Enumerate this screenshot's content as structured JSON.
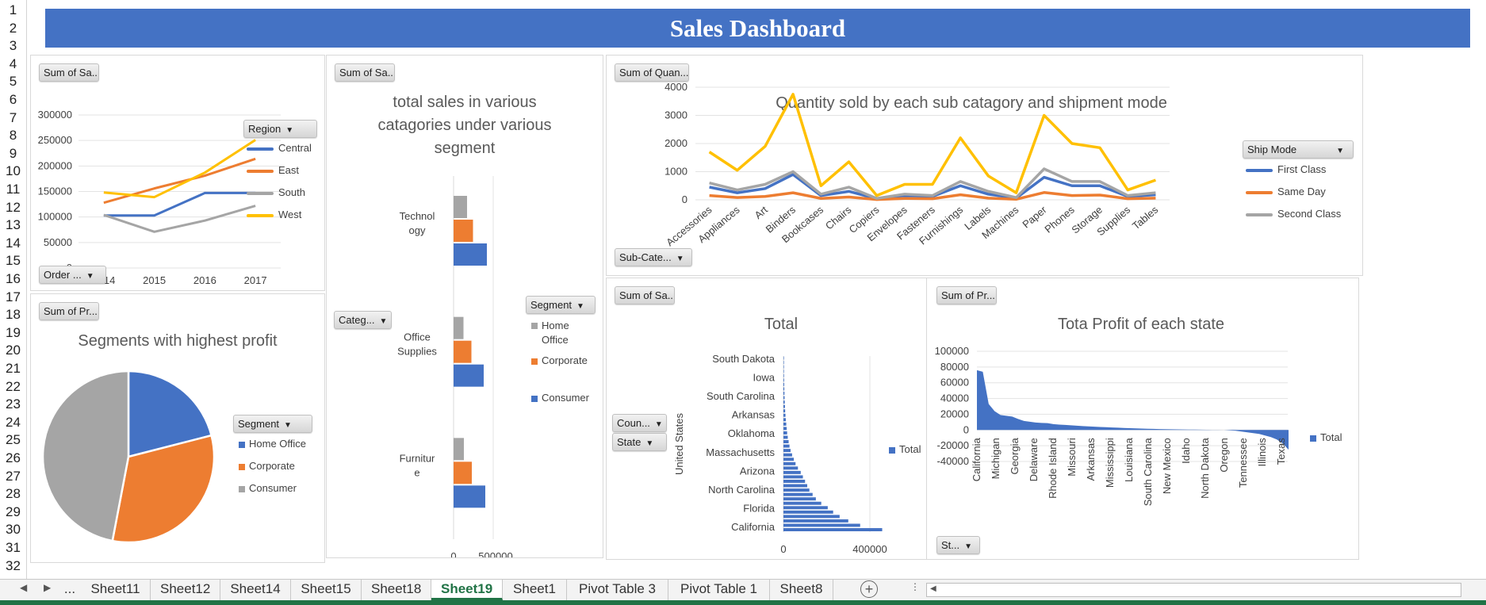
{
  "title": "Sales Dashboard",
  "rows": [
    "1",
    "2",
    "3",
    "4",
    "5",
    "6",
    "7",
    "8",
    "9",
    "10",
    "11",
    "12",
    "13",
    "14",
    "15",
    "16",
    "17",
    "18",
    "19",
    "20",
    "21",
    "22",
    "23",
    "24",
    "25",
    "26",
    "27",
    "28",
    "29",
    "30",
    "31",
    "32"
  ],
  "colors": {
    "blue": "#4472c4",
    "orange": "#ed7d31",
    "gray": "#a5a5a5",
    "yellow": "#ffc000",
    "excel_green": "#217346"
  },
  "region_chart": {
    "btn_value": "Sum of Sa...",
    "btn_axis": "Order ...",
    "btn_legend": "Region",
    "legend": [
      "Central",
      "East",
      "South",
      "West"
    ],
    "chart_data": {
      "type": "line",
      "x": [
        "2014",
        "2015",
        "2016",
        "2017"
      ],
      "yticks": [
        "300000",
        "250000",
        "200000",
        "150000",
        "100000",
        "50000",
        "0"
      ],
      "ylim": [
        0,
        300000
      ],
      "series": [
        {
          "name": "Central",
          "values": [
            103000,
            103000,
            147000,
            147000
          ]
        },
        {
          "name": "East",
          "values": [
            128000,
            156000,
            181000,
            214000
          ]
        },
        {
          "name": "South",
          "values": [
            104000,
            71000,
            93000,
            122000
          ]
        },
        {
          "name": "West",
          "values": [
            148000,
            139000,
            187000,
            251000
          ]
        }
      ]
    }
  },
  "segment_pie": {
    "title": "Segments with highest profit",
    "btn_value": "Sum of Pr...",
    "btn_legend": "Segment",
    "legend": [
      "Home Office",
      "Corporate",
      "Consumer"
    ],
    "chart_data": {
      "type": "pie",
      "labels": [
        "Home Office",
        "Corporate",
        "Consumer"
      ],
      "values": [
        21,
        32,
        47
      ]
    }
  },
  "category_chart": {
    "title_lines": [
      "total sales in various",
      "catagories under various",
      "segment"
    ],
    "btn_value": "Sum of Sa...",
    "btn_axis": "Categ...",
    "btn_legend": "Segment",
    "legend": [
      "Home Office",
      "Corporate",
      "Consumer"
    ],
    "category_labels": [
      [
        "Technol",
        "ogy"
      ],
      [
        "Office",
        "Supplies"
      ],
      [
        "Furnitur",
        "e"
      ]
    ],
    "xticks": [
      "0",
      "500000"
    ],
    "chart_data": {
      "type": "bar",
      "categories": [
        "Technology",
        "Office Supplies",
        "Furniture"
      ],
      "xlim": [
        0,
        1000000
      ],
      "series": [
        {
          "name": "Home Office",
          "values": [
            170000,
            125000,
            130000
          ]
        },
        {
          "name": "Corporate",
          "values": [
            245000,
            225000,
            230000
          ]
        },
        {
          "name": "Consumer",
          "values": [
            420000,
            380000,
            400000
          ]
        }
      ]
    }
  },
  "quantity_chart": {
    "title": "Quantity sold by each sub catagory and shipment mode",
    "btn_value": "Sum of Quan...",
    "btn_axis": "Sub-Cate...",
    "btn_legend": "Ship Mode",
    "legend": [
      "First Class",
      "Same Day",
      "Second Class"
    ],
    "chart_data": {
      "type": "line",
      "x": [
        "Accessories",
        "Appliances",
        "Art",
        "Binders",
        "Bookcases",
        "Chairs",
        "Copiers",
        "Envelopes",
        "Fasteners",
        "Furnishings",
        "Labels",
        "Machines",
        "Paper",
        "Phones",
        "Storage",
        "Supplies",
        "Tables"
      ],
      "yticks": [
        "4000",
        "3000",
        "2000",
        "1000",
        "0"
      ],
      "ylim": [
        0,
        4000
      ],
      "series": [
        {
          "name": "First Class",
          "values": [
            450,
            250,
            400,
            900,
            150,
            300,
            40,
            150,
            120,
            500,
            200,
            60,
            800,
            500,
            500,
            120,
            180
          ]
        },
        {
          "name": "Same Day",
          "values": [
            150,
            80,
            120,
            250,
            50,
            100,
            10,
            50,
            40,
            180,
            60,
            20,
            260,
            150,
            170,
            40,
            60
          ]
        },
        {
          "name": "Second Class",
          "values": [
            600,
            350,
            550,
            1000,
            200,
            450,
            50,
            200,
            150,
            650,
            300,
            80,
            1100,
            650,
            650,
            150,
            250
          ]
        },
        {
          "name": "",
          "values": [
            1700,
            1050,
            1900,
            3750,
            500,
            1350,
            150,
            550,
            550,
            2200,
            850,
            250,
            3000,
            2000,
            1850,
            350,
            700
          ]
        }
      ]
    }
  },
  "state_sales_chart": {
    "title": "Total",
    "btn_value": "Sum of Sa...",
    "btn_country": "Coun...",
    "btn_state": "State",
    "country_label": "United States",
    "legend": [
      "Total"
    ],
    "state_labels": [
      "South Dakota",
      "Iowa",
      "South Carolina",
      "Arkansas",
      "Oklahoma",
      "Massachusetts",
      "Arizona",
      "North Carolina",
      "Florida",
      "California"
    ],
    "xticks": [
      "0",
      "400000"
    ],
    "chart_data": {
      "type": "bar",
      "xlim": [
        0,
        600000
      ],
      "values": [
        1300,
        1500,
        1800,
        2100,
        2500,
        3000,
        3500,
        4000,
        4600,
        5300,
        6000,
        7000,
        8000,
        9500,
        11000,
        13000,
        15000,
        17000,
        20000,
        24000,
        28000,
        33000,
        40000,
        48000,
        56000,
        67000,
        80000,
        90000,
        100000,
        110000,
        120000,
        135000,
        150000,
        175000,
        205000,
        230000,
        260000,
        300000,
        355000,
        457000
      ]
    }
  },
  "state_profit_chart": {
    "title": "Tota Profit of each state",
    "btn_value": "Sum of Pr...",
    "btn_axis": "St...",
    "legend": [
      "Total"
    ],
    "xlabels": [
      "California",
      "Michigan",
      "Georgia",
      "Delaware",
      "Rhode Island",
      "Missouri",
      "Arkansas",
      "Mississippi",
      "Louisiana",
      "South Carolina",
      "New Mexico",
      "Idaho",
      "North Dakota",
      "Oregon",
      "Tennessee",
      "Illinois",
      "Texas"
    ],
    "yticks": [
      "100000",
      "80000",
      "60000",
      "40000",
      "20000",
      "0",
      "-20000",
      "-40000"
    ],
    "chart_data": {
      "type": "area",
      "ylim": [
        -40000,
        100000
      ],
      "values": [
        76000,
        74000,
        33000,
        24000,
        19000,
        18000,
        17000,
        14000,
        11500,
        10500,
        9500,
        9000,
        8700,
        7500,
        6800,
        6500,
        6000,
        5500,
        5000,
        4600,
        4200,
        3800,
        3500,
        3200,
        2900,
        2600,
        2300,
        2000,
        1800,
        1600,
        1400,
        1200,
        1000,
        900,
        800,
        700,
        600,
        500,
        400,
        300,
        200,
        100,
        0,
        -500,
        -1000,
        -2000,
        -3000,
        -4000,
        -5000,
        -7000,
        -9000,
        -12000,
        -17000,
        -25000
      ]
    }
  },
  "tabs": [
    "...",
    "Sheet11",
    "Sheet12",
    "Sheet14",
    "Sheet15",
    "Sheet18",
    "Sheet19",
    "Sheet1",
    "Pivot Table 3",
    "Pivot Table 1",
    "Sheet8"
  ],
  "active_tab": "Sheet19",
  "add_sheet": "+"
}
